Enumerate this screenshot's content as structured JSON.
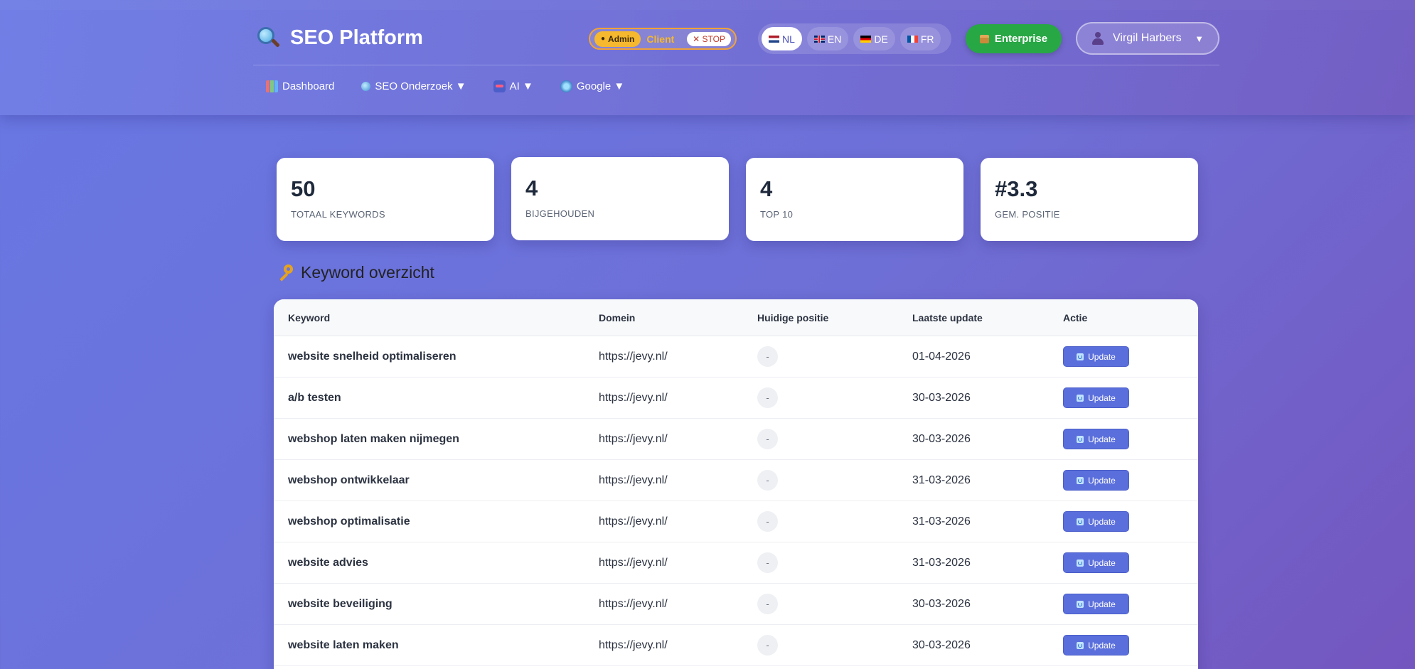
{
  "header": {
    "brand_title": "SEO Platform",
    "role_switch": {
      "admin_label": "Admin",
      "client_label": "Client",
      "stop_label": "✕ STOP"
    },
    "languages": [
      {
        "code": "NL",
        "active": true
      },
      {
        "code": "EN",
        "active": false
      },
      {
        "code": "DE",
        "active": false
      },
      {
        "code": "FR",
        "active": false
      }
    ],
    "enterprise_label": "Enterprise",
    "user_name": "Virgil Harbers",
    "user_caret": "▼"
  },
  "nav": [
    {
      "label": "Dashboard",
      "icon": "chart-icon"
    },
    {
      "label": "SEO Onderzoek ▼",
      "icon": "search-icon"
    },
    {
      "label": "AI ▼",
      "icon": "ai-icon"
    },
    {
      "label": "Google ▼",
      "icon": "globe-icon"
    }
  ],
  "stats": [
    {
      "value": "50",
      "label": "TOTAAL KEYWORDS"
    },
    {
      "value": "4",
      "label": "BIJGEHOUDEN"
    },
    {
      "value": "4",
      "label": "TOP 10"
    },
    {
      "value": "#3.3",
      "label": "GEM. POSITIE"
    }
  ],
  "section_title": "Keyword overzicht",
  "table": {
    "headers": {
      "keyword": "Keyword",
      "domain": "Domein",
      "position": "Huidige positie",
      "updated": "Laatste update",
      "action": "Actie"
    },
    "update_label": "Update",
    "rows": [
      {
        "keyword": "website snelheid optimaliseren",
        "domain": "https://jevy.nl/",
        "position": "-",
        "updated": "01-04-2026"
      },
      {
        "keyword": "a/b testen",
        "domain": "https://jevy.nl/",
        "position": "-",
        "updated": "30-03-2026"
      },
      {
        "keyword": "webshop laten maken nijmegen",
        "domain": "https://jevy.nl/",
        "position": "-",
        "updated": "30-03-2026"
      },
      {
        "keyword": "webshop ontwikkelaar",
        "domain": "https://jevy.nl/",
        "position": "-",
        "updated": "31-03-2026"
      },
      {
        "keyword": "webshop optimalisatie",
        "domain": "https://jevy.nl/",
        "position": "-",
        "updated": "31-03-2026"
      },
      {
        "keyword": "website advies",
        "domain": "https://jevy.nl/",
        "position": "-",
        "updated": "31-03-2026"
      },
      {
        "keyword": "website beveiliging",
        "domain": "https://jevy.nl/",
        "position": "-",
        "updated": "30-03-2026"
      },
      {
        "keyword": "website laten maken",
        "domain": "https://jevy.nl/",
        "position": "-",
        "updated": "30-03-2026"
      }
    ]
  }
}
